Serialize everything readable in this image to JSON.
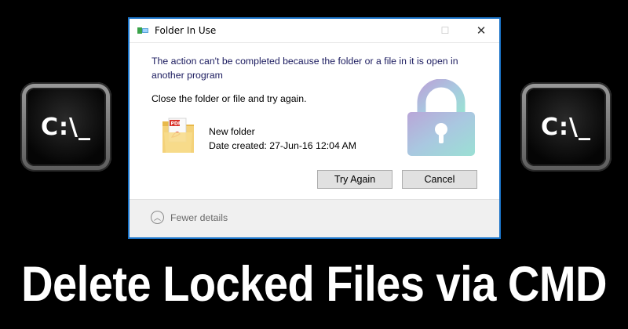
{
  "cmd_icon": {
    "prompt": "C:\\_"
  },
  "dialog": {
    "title": "Folder In Use",
    "controls": {
      "minimize": "—",
      "maximize": "☐",
      "close": "✕"
    },
    "message": "The action can't be completed because the folder or a file in it is open in another program",
    "instruction": "Close the folder or file and try again.",
    "file": {
      "name": "New folder",
      "date_created": "Date created: 27-Jun-16 12:04 AM",
      "icon": "pdf-folder-icon"
    },
    "lock_icon": "lock-icon",
    "buttons": {
      "try_again": "Try Again",
      "cancel": "Cancel"
    },
    "footer": {
      "fewer_details": "Fewer details",
      "chevron": "︿"
    },
    "colors": {
      "accent": "#1a73c8",
      "message_text": "#1a1a5e"
    }
  },
  "headline": "Delete Locked Files via CMD"
}
